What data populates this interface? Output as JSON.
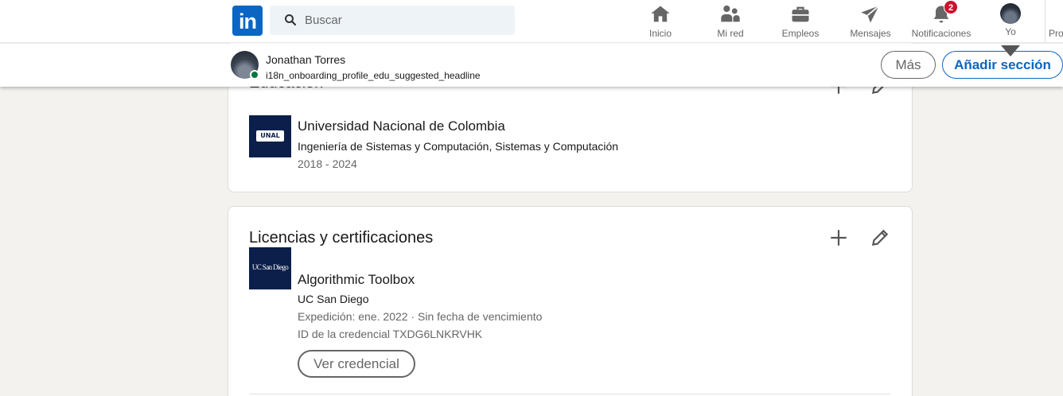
{
  "nav": {
    "logo": "in",
    "search_placeholder": "Buscar",
    "items": [
      {
        "label": "Inicio",
        "icon": "home-icon"
      },
      {
        "label": "Mi red",
        "icon": "people-icon"
      },
      {
        "label": "Empleos",
        "icon": "briefcase-icon"
      },
      {
        "label": "Mensajes",
        "icon": "paper-plane-icon"
      },
      {
        "label": "Notificaciones",
        "icon": "bell-icon",
        "badge": "2"
      },
      {
        "label": "Yo",
        "icon": "avatar"
      },
      {
        "label": "Pro"
      }
    ]
  },
  "sticky": {
    "name": "Jonathan Torres",
    "headline": "i18n_onboarding_profile_edu_suggested_headline",
    "more_label": "Más",
    "add_section_label": "Añadir sección"
  },
  "education": {
    "title": "Educación",
    "entries": [
      {
        "logo_text": "UNAL",
        "school": "Universidad Nacional de Colombia",
        "degree": "Ingeniería de Sistemas y Computación, Sistemas y Computación",
        "dates": "2018 - 2024"
      }
    ]
  },
  "certifications": {
    "title": "Licencias y certificaciones",
    "entries": [
      {
        "logo_text": "UC San Diego",
        "name": "Algorithmic Toolbox",
        "issuer": "UC San Diego",
        "issued": "Expedición: ene. 2022 · Sin fecha de vencimiento",
        "credential_id": "ID de la credencial TXDG6LNKRVHK",
        "button_label": "Ver credencial"
      }
    ]
  },
  "colors": {
    "brand": "#0a66c2",
    "badge": "#cb112d",
    "online": "#057642",
    "page_bg": "#f3f2ef"
  }
}
